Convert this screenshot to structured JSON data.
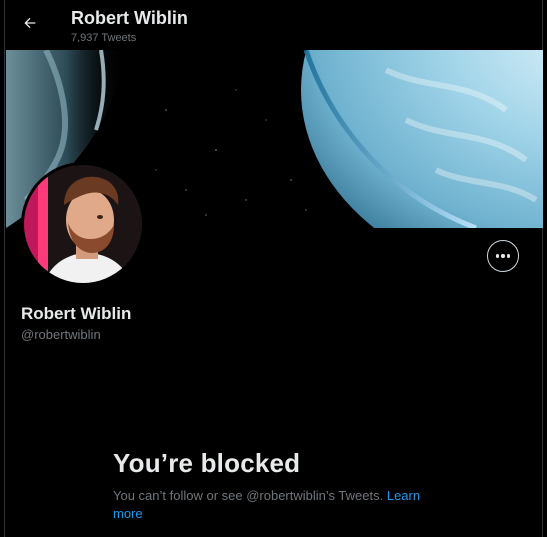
{
  "header": {
    "back_icon": "arrow-left-icon",
    "title": "Robert Wiblin",
    "subtitle": "7,937 Tweets"
  },
  "profile": {
    "display_name": "Robert Wiblin",
    "handle": "@robertwiblin",
    "more_icon": "more-horizontal-icon"
  },
  "blocked": {
    "title": "You’re blocked",
    "message": "You can’t follow or see @robertwiblin’s Tweets.",
    "learn_more": "Learn more"
  },
  "colors": {
    "background": "#000000",
    "primary_text": "#e7e9ea",
    "secondary_text": "#71767b",
    "link": "#1d9bf0"
  }
}
